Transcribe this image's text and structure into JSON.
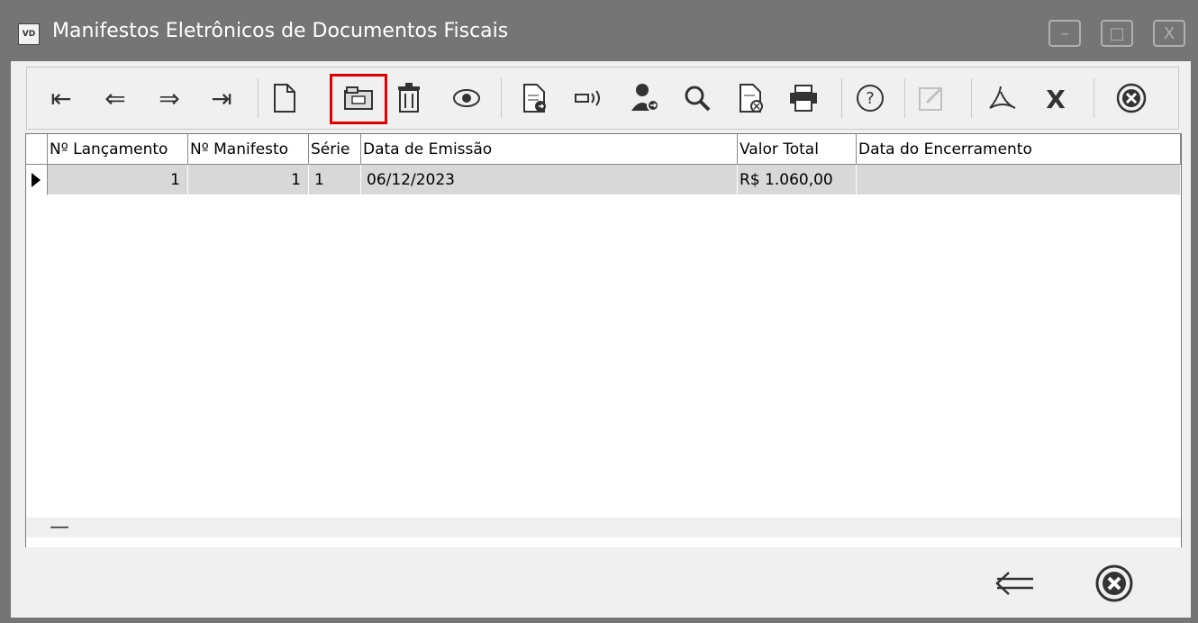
{
  "window": {
    "app_icon_text": "VD",
    "title": "Manifestos Eletrônicos de Documentos Fiscais",
    "minimize": "–",
    "maximize": "□",
    "close": "X"
  },
  "toolbar": {
    "first": "⇤",
    "prev": "⇐",
    "next": "⇒",
    "last": "⇥",
    "new": "🗋",
    "open_icon": "open-folder-icon",
    "delete": "🗑",
    "view": "◉",
    "highlighted_button": "open-folder"
  },
  "grid": {
    "columns": [
      "Nº Lançamento",
      "Nº Manifesto",
      "Série",
      "Data de Emissão",
      "Valor Total",
      "Data do Encerramento"
    ],
    "rows": [
      {
        "lancamento": "1",
        "manifesto": "1",
        "serie": "1",
        "data_emissao": "06/12/2023",
        "valor_total": "R$ 1.060,00",
        "data_encerramento": ""
      }
    ],
    "footer_mark": "—"
  },
  "colors": {
    "titlebar": "#757575",
    "highlight": "#e00000",
    "row_bg": "#d8d8d8"
  }
}
